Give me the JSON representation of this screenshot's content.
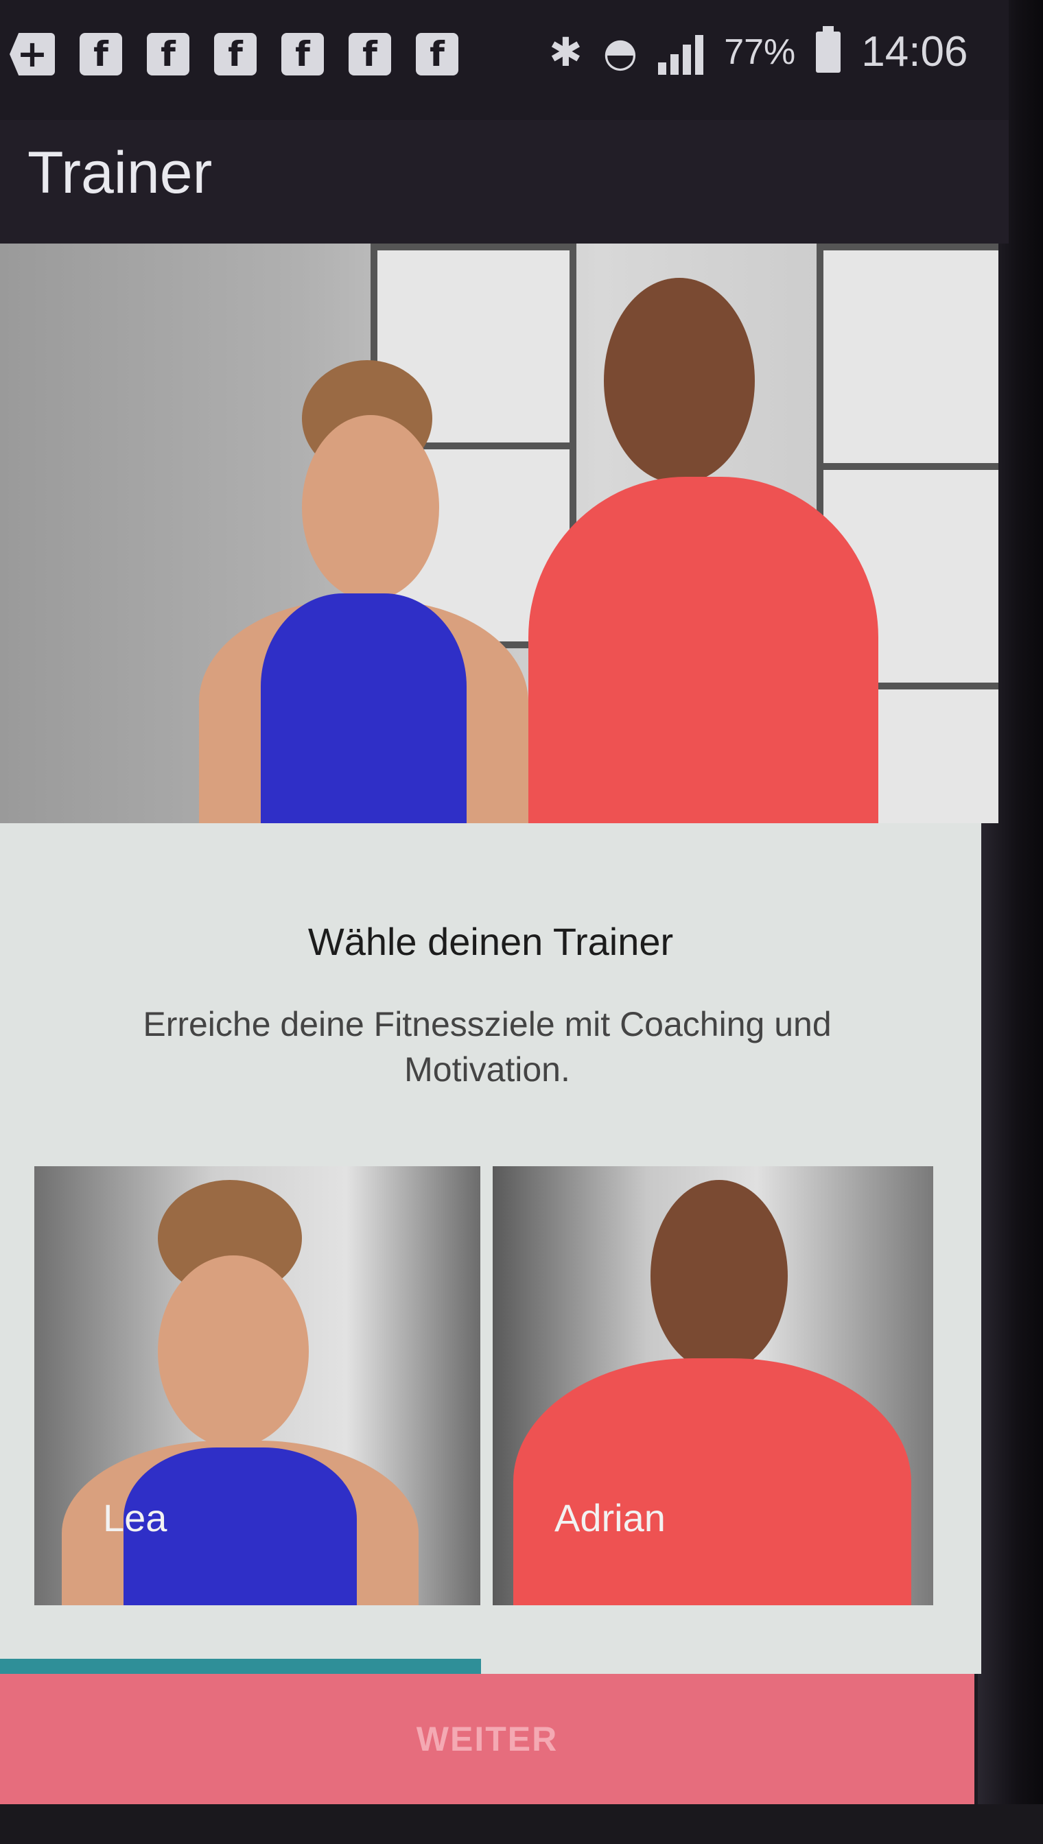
{
  "status_bar": {
    "notifications": [
      "+",
      "f",
      "f",
      "f",
      "f",
      "f",
      "f"
    ],
    "battery_percent": "77%",
    "time": "14:06"
  },
  "toolbar": {
    "title": "Trainer"
  },
  "main": {
    "headline": "Wähle deinen Trainer",
    "subtext": "Erreiche deine Fitnessziele mit Coaching und Motivation.",
    "trainers": [
      {
        "name": "Lea"
      },
      {
        "name": "Adrian"
      }
    ]
  },
  "progress": {
    "fraction": 0.49,
    "color": "#2f8f98"
  },
  "footer": {
    "button_label": "WEITER"
  },
  "colors": {
    "accent": "#e66d7d",
    "toolbar": "#221e27"
  }
}
